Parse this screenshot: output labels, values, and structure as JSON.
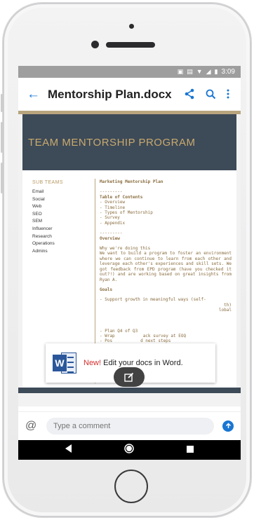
{
  "status_bar": {
    "time": "3:09"
  },
  "app_bar": {
    "title": "Mentorship Plan.docx",
    "back_icon": "arrow-left-icon",
    "share_icon": "share-icon",
    "search_icon": "search-icon",
    "more_icon": "more-vert-icon"
  },
  "document": {
    "banner_title": "TEAM MENTORSHIP PROGRAM",
    "sub_teams": {
      "heading": "SUB TEAMS",
      "items": [
        "Email",
        "Social",
        "Web",
        "SEO",
        "SEM",
        "Influencer",
        "Research",
        "Operations",
        "Admins"
      ]
    },
    "content": {
      "plan_title": "Marketing Mentorship Plan",
      "rule1": "---------",
      "toc_heading": "Table of Contents",
      "toc_items": [
        "- Overview",
        "- Timeline",
        "- Types of Mentorship",
        "- Survey",
        "- Appendix"
      ],
      "rule2": "---------",
      "overview_heading": "Overview",
      "why_heading": "Why we're doing this",
      "why_text": "We want to build a program to foster an environment where we can continue to learn from each other and leverage each other's experiences and skill sets. We got feedback from EPD program (have you checked it out?!) and are working based on great insights from Ryan A.",
      "goals_heading": "Goals",
      "goal1": "- Support growth in meaningful ways (self-",
      "goal_partial2": "th)",
      "goal_partial3": "lobal",
      "goal_partial4": "- Plan Q4 of Q3",
      "goal5_a": "- Wrap",
      "goal5_b": "ack survey at EOQ",
      "goal6_a": "- Pos",
      "goal6_b": "d next steps"
    }
  },
  "toast": {
    "new_label": "New!",
    "message": " Edit your docs in Word.",
    "icon": "word-app-icon"
  },
  "fab": {
    "icon": "edit-icon"
  },
  "comment_bar": {
    "at_icon": "at-sign-icon",
    "placeholder": "Type a comment",
    "send_icon": "send-arrow-icon"
  },
  "nav_bar": {
    "back_icon": "nav-back-icon",
    "home_icon": "nav-home-icon",
    "recents_icon": "nav-recents-icon"
  },
  "colors": {
    "accent": "#1976d2",
    "banner": "#3d4a58",
    "banner_text": "#c9aa6e",
    "gold": "#b8a57e",
    "new_red": "#d32f2f"
  }
}
